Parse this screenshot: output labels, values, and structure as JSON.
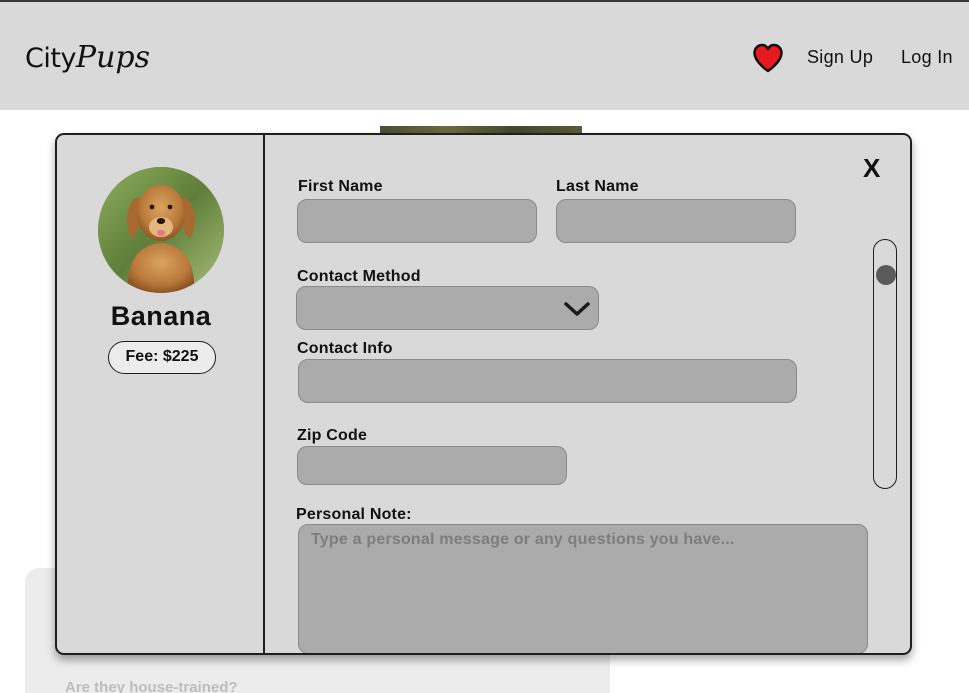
{
  "header": {
    "logo_part1": "City",
    "logo_part2": "Pups",
    "heart_color": "#e8191f",
    "signup_label": "Sign Up",
    "login_label": "Log In"
  },
  "background": {
    "question": "Are they house-trained?"
  },
  "modal": {
    "close_label": "X",
    "dog": {
      "name": "Banana",
      "fee": "Fee: $225"
    },
    "form": {
      "first_name_label": "First Name",
      "last_name_label": "Last Name",
      "contact_method_label": "Contact Method",
      "contact_info_label": "Contact Info",
      "zip_code_label": "Zip Code",
      "personal_note_label": "Personal Note:",
      "personal_note_placeholder": "Type a personal message or any questions you have..."
    }
  },
  "icons": {
    "heart": "heart-icon",
    "chevron": "chevron-down-icon",
    "close": "close-icon"
  },
  "colors": {
    "header_bg": "#d9d9d9",
    "modal_bg": "#d9d9d9",
    "field_bg": "#ababab",
    "heart": "#e8191f"
  }
}
